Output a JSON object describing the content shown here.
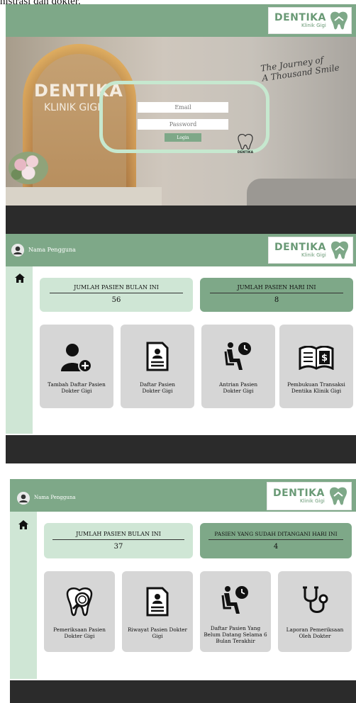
{
  "caption": "nistrasi dan dokter.",
  "brand": {
    "name": "DENTIKA",
    "sub": "Klinik Gigi"
  },
  "login": {
    "photo_brand": "DENTIKA",
    "photo_brand_sub": "KLINIK GIGI",
    "journey_line1": "The Journey of",
    "journey_line2": "A Thousand Smile",
    "email_placeholder": "Email",
    "password_placeholder": "Password",
    "login_label": "Login",
    "small_logo_text": "DENTIKA"
  },
  "admin": {
    "user_name": "Nama Pengguna",
    "stat_month_title": "JUMLAH PASIEN BULAN INI",
    "stat_month_value": "56",
    "stat_today_title": "JUMLAH PASIEN HARI INI",
    "stat_today_value": "8",
    "menu": [
      {
        "line1": "Tambah Daftar Pasien",
        "line2": "Dokter Gigi",
        "line3": ""
      },
      {
        "line1": "Daftar Pasien",
        "line2": "Dokter Gigi",
        "line3": ""
      },
      {
        "line1": "Antrian Pasien",
        "line2": "Dokter Gigi",
        "line3": ""
      },
      {
        "line1": "Pembukuan Transaksi",
        "line2": "Dentika Klinik Gigi",
        "line3": ""
      }
    ]
  },
  "doctor": {
    "user_name": "Nama Pengguna",
    "stat_month_title": "JUMLAH PASIEN BULAN INI",
    "stat_month_value": "37",
    "stat_today_title": "PASIEN YANG SUDAH DITANGANI HARI INI",
    "stat_today_value": "4",
    "menu": [
      {
        "line1": "Pemeriksaan Pasien",
        "line2": "Dokter Gigi",
        "line3": ""
      },
      {
        "line1": "Riwayat Pasien Dokter",
        "line2": "Gigi",
        "line3": ""
      },
      {
        "line1": "Daftar Pasien Yang",
        "line2": "Belum Datang Selama 6",
        "line3": "Bulan Terakhir"
      },
      {
        "line1": "Laporan Pemeriksaan",
        "line2": "Oleh Dokter",
        "line3": ""
      }
    ]
  },
  "colors": {
    "green": "#7ea888",
    "light_green": "#cfe6d5",
    "card_gray": "#d6d6d6",
    "dark_bar": "#2b2b2b"
  },
  "icons": {
    "home": "home-icon",
    "user": "user-circle-icon",
    "add_user": "add-user-icon",
    "document": "document-icon",
    "queue": "waiting-patient-icon",
    "ledger": "money-book-icon",
    "tooth": "tooth-exam-icon",
    "stethoscope": "stethoscope-icon"
  }
}
